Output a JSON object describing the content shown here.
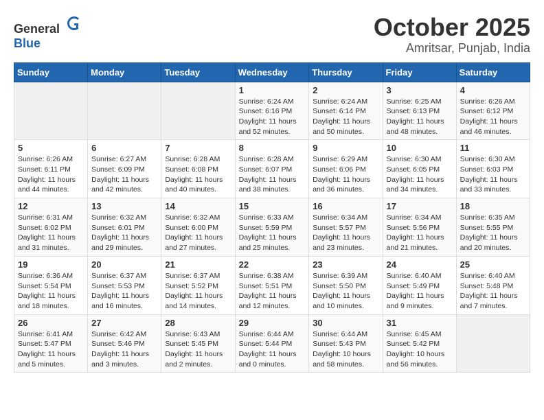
{
  "header": {
    "logo_general": "General",
    "logo_blue": "Blue",
    "month": "October 2025",
    "location": "Amritsar, Punjab, India"
  },
  "days_of_week": [
    "Sunday",
    "Monday",
    "Tuesday",
    "Wednesday",
    "Thursday",
    "Friday",
    "Saturday"
  ],
  "weeks": [
    [
      {
        "day": "",
        "info": ""
      },
      {
        "day": "",
        "info": ""
      },
      {
        "day": "",
        "info": ""
      },
      {
        "day": "1",
        "info": "Sunrise: 6:24 AM\nSunset: 6:16 PM\nDaylight: 11 hours\nand 52 minutes."
      },
      {
        "day": "2",
        "info": "Sunrise: 6:24 AM\nSunset: 6:14 PM\nDaylight: 11 hours\nand 50 minutes."
      },
      {
        "day": "3",
        "info": "Sunrise: 6:25 AM\nSunset: 6:13 PM\nDaylight: 11 hours\nand 48 minutes."
      },
      {
        "day": "4",
        "info": "Sunrise: 6:26 AM\nSunset: 6:12 PM\nDaylight: 11 hours\nand 46 minutes."
      }
    ],
    [
      {
        "day": "5",
        "info": "Sunrise: 6:26 AM\nSunset: 6:11 PM\nDaylight: 11 hours\nand 44 minutes."
      },
      {
        "day": "6",
        "info": "Sunrise: 6:27 AM\nSunset: 6:09 PM\nDaylight: 11 hours\nand 42 minutes."
      },
      {
        "day": "7",
        "info": "Sunrise: 6:28 AM\nSunset: 6:08 PM\nDaylight: 11 hours\nand 40 minutes."
      },
      {
        "day": "8",
        "info": "Sunrise: 6:28 AM\nSunset: 6:07 PM\nDaylight: 11 hours\nand 38 minutes."
      },
      {
        "day": "9",
        "info": "Sunrise: 6:29 AM\nSunset: 6:06 PM\nDaylight: 11 hours\nand 36 minutes."
      },
      {
        "day": "10",
        "info": "Sunrise: 6:30 AM\nSunset: 6:05 PM\nDaylight: 11 hours\nand 34 minutes."
      },
      {
        "day": "11",
        "info": "Sunrise: 6:30 AM\nSunset: 6:03 PM\nDaylight: 11 hours\nand 33 minutes."
      }
    ],
    [
      {
        "day": "12",
        "info": "Sunrise: 6:31 AM\nSunset: 6:02 PM\nDaylight: 11 hours\nand 31 minutes."
      },
      {
        "day": "13",
        "info": "Sunrise: 6:32 AM\nSunset: 6:01 PM\nDaylight: 11 hours\nand 29 minutes."
      },
      {
        "day": "14",
        "info": "Sunrise: 6:32 AM\nSunset: 6:00 PM\nDaylight: 11 hours\nand 27 minutes."
      },
      {
        "day": "15",
        "info": "Sunrise: 6:33 AM\nSunset: 5:59 PM\nDaylight: 11 hours\nand 25 minutes."
      },
      {
        "day": "16",
        "info": "Sunrise: 6:34 AM\nSunset: 5:57 PM\nDaylight: 11 hours\nand 23 minutes."
      },
      {
        "day": "17",
        "info": "Sunrise: 6:34 AM\nSunset: 5:56 PM\nDaylight: 11 hours\nand 21 minutes."
      },
      {
        "day": "18",
        "info": "Sunrise: 6:35 AM\nSunset: 5:55 PM\nDaylight: 11 hours\nand 20 minutes."
      }
    ],
    [
      {
        "day": "19",
        "info": "Sunrise: 6:36 AM\nSunset: 5:54 PM\nDaylight: 11 hours\nand 18 minutes."
      },
      {
        "day": "20",
        "info": "Sunrise: 6:37 AM\nSunset: 5:53 PM\nDaylight: 11 hours\nand 16 minutes."
      },
      {
        "day": "21",
        "info": "Sunrise: 6:37 AM\nSunset: 5:52 PM\nDaylight: 11 hours\nand 14 minutes."
      },
      {
        "day": "22",
        "info": "Sunrise: 6:38 AM\nSunset: 5:51 PM\nDaylight: 11 hours\nand 12 minutes."
      },
      {
        "day": "23",
        "info": "Sunrise: 6:39 AM\nSunset: 5:50 PM\nDaylight: 11 hours\nand 10 minutes."
      },
      {
        "day": "24",
        "info": "Sunrise: 6:40 AM\nSunset: 5:49 PM\nDaylight: 11 hours\nand 9 minutes."
      },
      {
        "day": "25",
        "info": "Sunrise: 6:40 AM\nSunset: 5:48 PM\nDaylight: 11 hours\nand 7 minutes."
      }
    ],
    [
      {
        "day": "26",
        "info": "Sunrise: 6:41 AM\nSunset: 5:47 PM\nDaylight: 11 hours\nand 5 minutes."
      },
      {
        "day": "27",
        "info": "Sunrise: 6:42 AM\nSunset: 5:46 PM\nDaylight: 11 hours\nand 3 minutes."
      },
      {
        "day": "28",
        "info": "Sunrise: 6:43 AM\nSunset: 5:45 PM\nDaylight: 11 hours\nand 2 minutes."
      },
      {
        "day": "29",
        "info": "Sunrise: 6:44 AM\nSunset: 5:44 PM\nDaylight: 11 hours\nand 0 minutes."
      },
      {
        "day": "30",
        "info": "Sunrise: 6:44 AM\nSunset: 5:43 PM\nDaylight: 10 hours\nand 58 minutes."
      },
      {
        "day": "31",
        "info": "Sunrise: 6:45 AM\nSunset: 5:42 PM\nDaylight: 10 hours\nand 56 minutes."
      },
      {
        "day": "",
        "info": ""
      }
    ]
  ]
}
